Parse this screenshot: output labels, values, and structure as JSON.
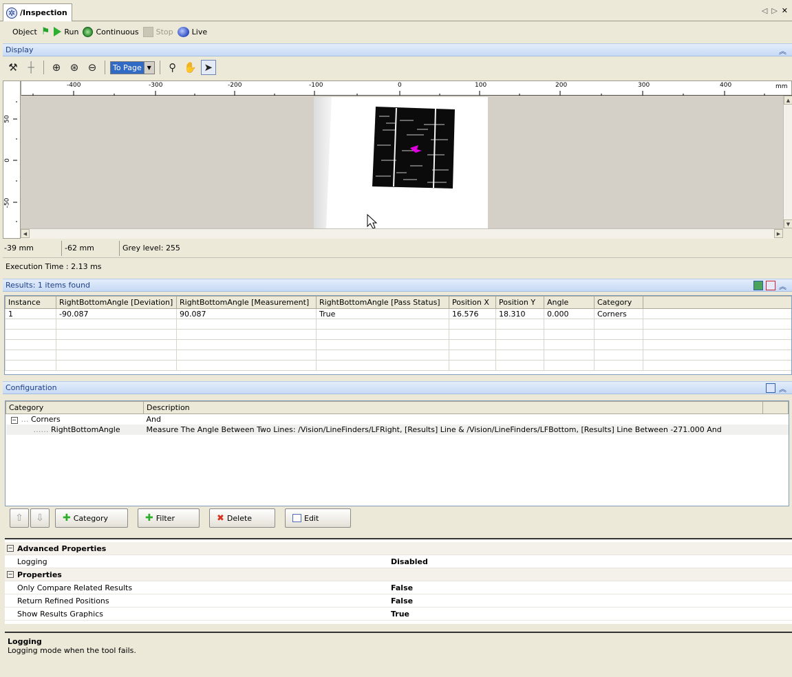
{
  "tab": {
    "title": "/Inspection",
    "nav_prev": "◁",
    "nav_next": "▷",
    "close": "✕"
  },
  "toolbar": {
    "object": "Object",
    "run": "Run",
    "continuous": "Continuous",
    "stop": "Stop",
    "live": "Live"
  },
  "display": {
    "header": "Display",
    "zoom_value": "To Page",
    "ruler_h": [
      "-400",
      "-300",
      "-200",
      "-100",
      "0",
      "100",
      "200",
      "300",
      "400",
      "mm"
    ],
    "ruler_v": [
      "50",
      "0",
      "-50"
    ],
    "status": {
      "x": "-39 mm",
      "y": "-62 mm",
      "grey": "Grey level: 255"
    },
    "execution_time": "Execution Time : 2.13 ms"
  },
  "results": {
    "header": "Results: 1 items found",
    "columns": [
      "Instance",
      "RightBottomAngle [Deviation]",
      "RightBottomAngle [Measurement]",
      "RightBottomAngle [Pass Status]",
      "Position X",
      "Position Y",
      "Angle",
      "Category"
    ],
    "rows": [
      [
        "1",
        "-90.087",
        "90.087",
        "True",
        "16.576",
        "18.310",
        "0.000",
        "Corners"
      ]
    ]
  },
  "configuration": {
    "header": "Configuration",
    "columns": [
      "Category",
      "Description"
    ],
    "rows": [
      {
        "category": "Corners",
        "description": "And"
      },
      {
        "category": "RightBottomAngle",
        "description": "Measure The Angle Between Two Lines: /Vision/LineFinders/LFRight, [Results] Line & /Vision/LineFinders/LFBottom, [Results] Line Between -271.000 And"
      }
    ],
    "buttons": {
      "category": "Category",
      "filter": "Filter",
      "delete": "Delete",
      "edit": "Edit"
    }
  },
  "properties": {
    "advanced_header": "Advanced Properties",
    "logging_label": "Logging",
    "logging_value": "Disabled",
    "props_header": "Properties",
    "items": [
      {
        "label": "Only Compare Related Results",
        "value": "False"
      },
      {
        "label": "Return Refined Positions",
        "value": "False"
      },
      {
        "label": "Show Results Graphics",
        "value": "True"
      }
    ]
  },
  "description": {
    "title": "Logging",
    "text": "Logging mode when the tool fails."
  }
}
